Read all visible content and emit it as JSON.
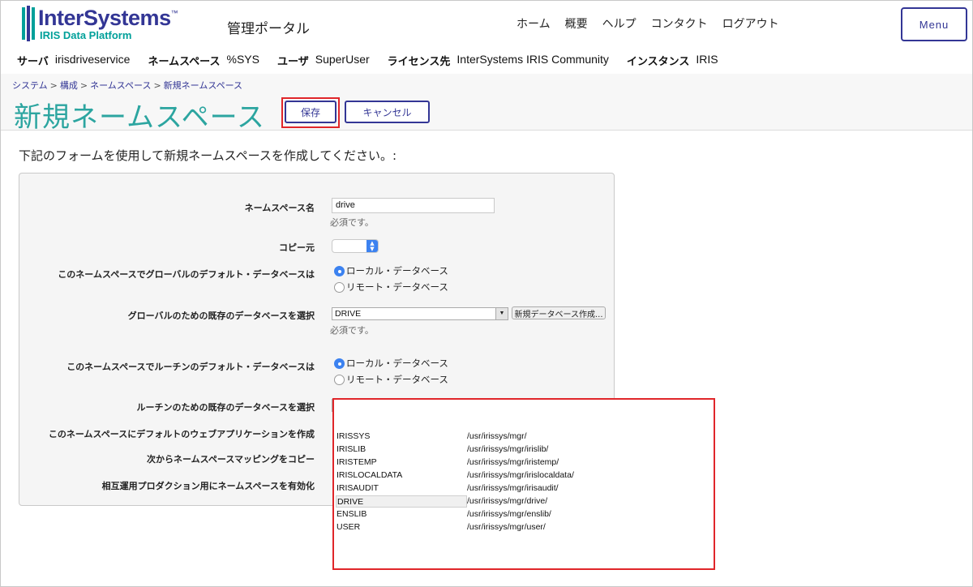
{
  "header": {
    "logo_name": "InterSystems",
    "logo_tm": "™",
    "logo_sub": "IRIS Data Platform",
    "portal_title": "管理ポータル",
    "nav": [
      "ホーム",
      "概要",
      "ヘルプ",
      "コンタクト",
      "ログアウト"
    ],
    "menu_label": "Menu",
    "info": [
      {
        "key": "サーバ",
        "value": "irisdriveservice"
      },
      {
        "key": "ネームスペース",
        "value": "%SYS"
      },
      {
        "key": "ユーザ",
        "value": "SuperUser"
      },
      {
        "key": "ライセンス先",
        "value": "InterSystems IRIS Community"
      },
      {
        "key": "インスタンス",
        "value": "IRIS"
      }
    ]
  },
  "breadcrumb": [
    "システム",
    "構成",
    "ネームスペース",
    "新規ネームスペース"
  ],
  "breadcrumb_sep": ">",
  "page_title": "新規ネームスペース",
  "buttons": {
    "save": "保存",
    "cancel": "キャンセル"
  },
  "instructions": "下記のフォームを使用して新規ネームスペースを作成してください。:",
  "form": {
    "namespace_label": "ネームスペース名",
    "namespace_value": "drive",
    "required_text": "必須です。",
    "copy_from_label": "コピー元",
    "global_default_label": "このネームスペースでグローバルのデフォルト・データベースは",
    "local_db": "ローカル・データベース",
    "remote_db": "リモート・データベース",
    "global_db_label": "グローバルのための既存のデータベースを選択",
    "global_db_value": "DRIVE",
    "new_db_button": "新規データベース作成...",
    "routine_default_label": "このネームスペースでルーチンのデフォルト・データベースは",
    "routine_db_label": "ルーチンのための既存のデータベースを選択",
    "routine_db_value": "",
    "web_app_label": "このネームスペースにデフォルトのウェブアプリケーションを作成",
    "copy_mapping_label": "次からネームスペースマッピングをコピー",
    "interop_label": "相互運用プロダクション用にネームスペースを有効化"
  },
  "dropdown_options": [
    {
      "name": "IRISSYS",
      "path": "/usr/irissys/mgr/"
    },
    {
      "name": "IRISLIB",
      "path": "/usr/irissys/mgr/irislib/"
    },
    {
      "name": "IRISTEMP",
      "path": "/usr/irissys/mgr/iristemp/"
    },
    {
      "name": "IRISLOCALDATA",
      "path": "/usr/irissys/mgr/irislocaldata/"
    },
    {
      "name": "IRISAUDIT",
      "path": "/usr/irissys/mgr/irisaudit/"
    },
    {
      "name": "DRIVE",
      "path": "/usr/irissys/mgr/drive/"
    },
    {
      "name": "ENSLIB",
      "path": "/usr/irissys/mgr/enslib/"
    },
    {
      "name": "USER",
      "path": "/usr/irissys/mgr/user/"
    }
  ],
  "colors": {
    "brand": "#333695",
    "teal": "#2ca5a0",
    "highlight": "#e0262a",
    "radio": "#3c82f0"
  }
}
